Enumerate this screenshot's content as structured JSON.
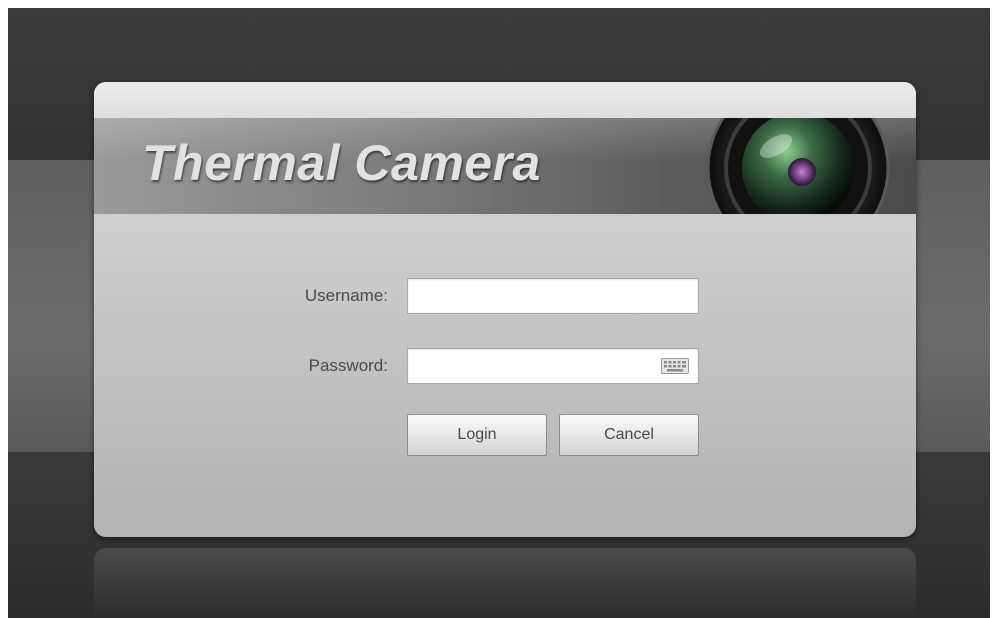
{
  "brand": {
    "title": "Thermal Camera"
  },
  "login_form": {
    "username_label": "Username:",
    "username_value": "",
    "password_label": "Password:",
    "password_value": "",
    "login_button": "Login",
    "cancel_button": "Cancel"
  },
  "icons": {
    "camera": "camera-lens-icon",
    "keyboard": "virtual-keyboard-icon"
  },
  "colors": {
    "background": "#2b2b2b",
    "panel": "#cdcdcd",
    "banner": "#6e6e6e",
    "title_text": "#e2e2e2",
    "label_text": "#4a4a4a"
  }
}
